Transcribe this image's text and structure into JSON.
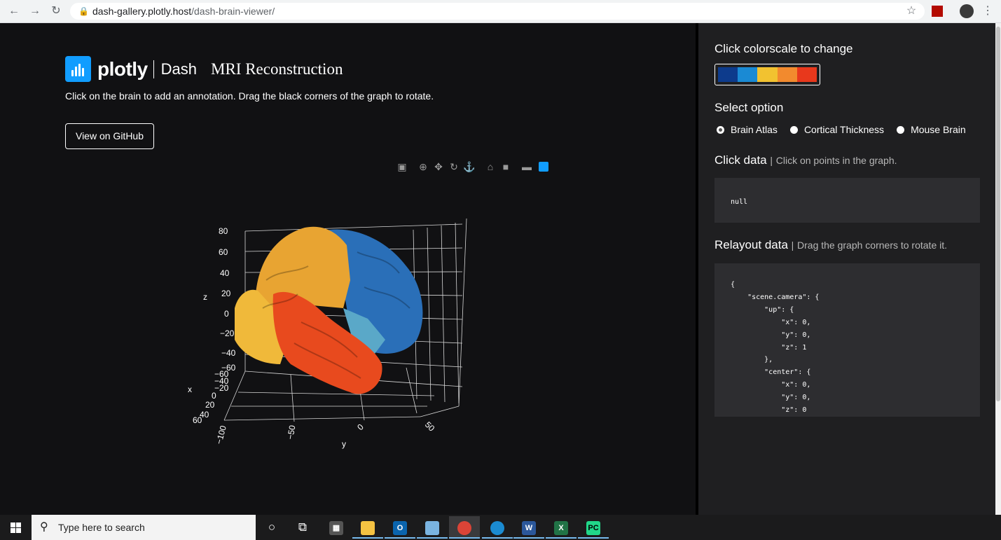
{
  "browser": {
    "url_host": "dash-gallery.plotly.host",
    "url_path": "/dash-brain-viewer/"
  },
  "header": {
    "brand": "plotly",
    "product": "Dash",
    "title": "MRI Reconstruction",
    "subtitle": "Click on the brain to add an annotation. Drag the black corners of the graph to rotate.",
    "github_label": "View on GitHub"
  },
  "modebar": {
    "icons": [
      "camera-icon",
      "zoom-icon",
      "pan-icon",
      "orbit-icon",
      "turntable-icon",
      "home-icon",
      "camera-reset-icon",
      "hover-icon",
      "plotly-logo-icon"
    ]
  },
  "chart_data": {
    "type": "mesh3d",
    "axes": {
      "x": {
        "label": "x",
        "ticks": [
          "−60",
          "−40",
          "−20",
          "0",
          "20",
          "40",
          "60"
        ]
      },
      "y": {
        "label": "y",
        "ticks": [
          "−100",
          "−50",
          "0",
          "50"
        ]
      },
      "z": {
        "label": "z",
        "ticks": [
          "80",
          "60",
          "40",
          "20",
          "0",
          "−20",
          "−40",
          "−60"
        ]
      }
    },
    "colors": {
      "frontal": "#e8a432",
      "parietal": "#2a6fb8",
      "temporal": "#e84a1e",
      "occipital": "#f0b93a",
      "insula": "#5aa8c8"
    }
  },
  "sidebar": {
    "colorscale_heading": "Click colorscale to change",
    "colorscale": [
      "#0d3b8c",
      "#1a8ad4",
      "#f2c230",
      "#f28a2e",
      "#e8381c"
    ],
    "option_heading": "Select option",
    "options": [
      {
        "label": "Brain Atlas",
        "selected": true
      },
      {
        "label": "Cortical Thickness",
        "selected": false
      },
      {
        "label": "Mouse Brain",
        "selected": false
      }
    ],
    "click_heading": "Click data",
    "click_sub": "Click on points in the graph.",
    "click_value": "null",
    "relayout_heading": "Relayout data",
    "relayout_sub": "Drag the graph corners to rotate it.",
    "relayout_value": "{\n    \"scene.camera\": {\n        \"up\": {\n            \"x\": 0,\n            \"y\": 0,\n            \"z\": 1\n        },\n        \"center\": {\n            \"x\": 0,\n            \"y\": 0,\n            \"z\": 0"
  },
  "taskbar": {
    "search_placeholder": "Type here to search",
    "apps": [
      "task-view",
      "calculator",
      "file-explorer",
      "outlook",
      "notepad",
      "chrome",
      "edge",
      "word",
      "excel",
      "pycharm"
    ]
  }
}
